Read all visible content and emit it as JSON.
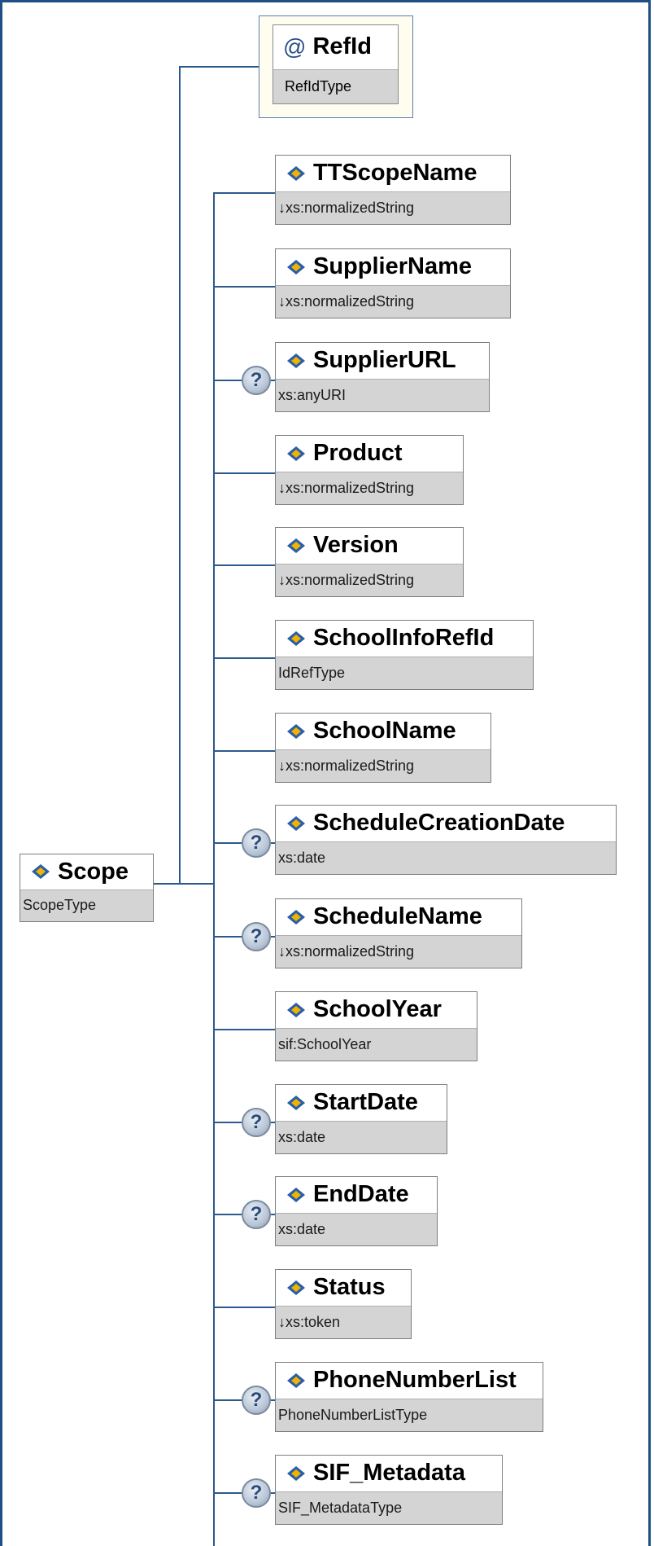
{
  "root": {
    "name": "Scope",
    "type": "ScopeType"
  },
  "attribute": {
    "symbol": "@",
    "name": "RefId",
    "type": "RefIdType"
  },
  "children": [
    {
      "name": "TTScopeName",
      "type": "↓xs:normalizedString",
      "optional": false
    },
    {
      "name": "SupplierName",
      "type": "↓xs:normalizedString",
      "optional": false
    },
    {
      "name": "SupplierURL",
      "type": "xs:anyURI",
      "optional": true
    },
    {
      "name": "Product",
      "type": "↓xs:normalizedString",
      "optional": false
    },
    {
      "name": "Version",
      "type": "↓xs:normalizedString",
      "optional": false
    },
    {
      "name": "SchoolInfoRefId",
      "type": "IdRefType",
      "optional": false
    },
    {
      "name": "SchoolName",
      "type": "↓xs:normalizedString",
      "optional": false
    },
    {
      "name": "ScheduleCreationDate",
      "type": "xs:date",
      "optional": true
    },
    {
      "name": "ScheduleName",
      "type": "↓xs:normalizedString",
      "optional": true
    },
    {
      "name": "SchoolYear",
      "type": "sif:SchoolYear",
      "optional": false
    },
    {
      "name": "StartDate",
      "type": "xs:date",
      "optional": true
    },
    {
      "name": "EndDate",
      "type": "xs:date",
      "optional": true
    },
    {
      "name": "Status",
      "type": "↓xs:token",
      "optional": false
    },
    {
      "name": "PhoneNumberList",
      "type": "PhoneNumberListType",
      "optional": true
    },
    {
      "name": "SIF_Metadata",
      "type": "SIF_MetadataType",
      "optional": true
    }
  ],
  "optional_marker": "?",
  "colors": {
    "frame": "#1f4f84",
    "connector": "#2c5a8c",
    "type_band": "#d4d4d4"
  },
  "icons": {
    "element": "element-diamond-icon",
    "optional": "question-icon"
  }
}
